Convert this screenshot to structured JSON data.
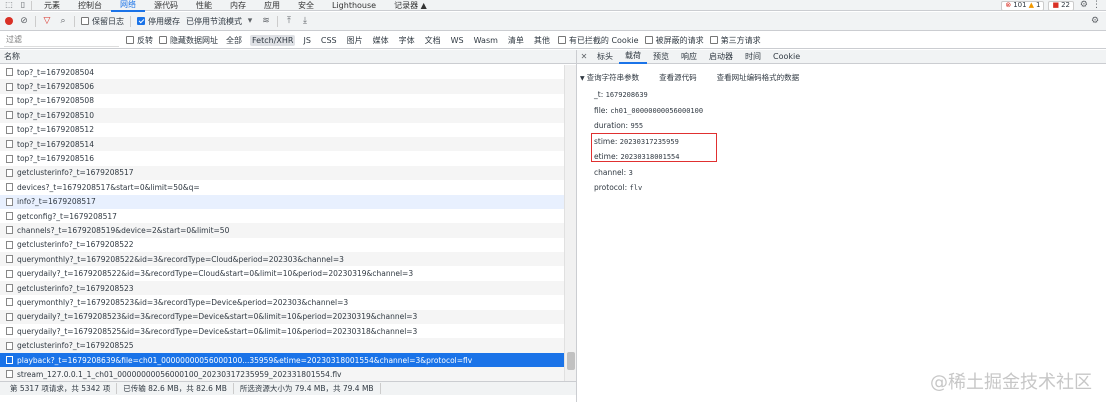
{
  "tabs": [
    "元素",
    "控制台",
    "网络",
    "源代码",
    "性能",
    "内存",
    "应用",
    "安全",
    "Lighthouse",
    "记录器 ▲"
  ],
  "active_tab": "网络",
  "counts": {
    "errors": "101",
    "warnings": "1",
    "issues": "22"
  },
  "toolbar": {
    "preserve_log": "保留日志",
    "disable_cache": "停用缓存",
    "throttle": "已停用节流模式"
  },
  "filter": {
    "placeholder": "过滤",
    "invert": "反转",
    "hide_data_urls": "隐藏数据网址",
    "types": [
      "全部",
      "Fetch/XHR",
      "JS",
      "CSS",
      "图片",
      "媒体",
      "字体",
      "文档",
      "WS",
      "Wasm",
      "清单",
      "其他"
    ],
    "selected_type": "Fetch/XHR",
    "blocked_cookies": "有已拦截的 Cookie",
    "blocked_requests": "被屏蔽的请求",
    "third_party": "第三方请求"
  },
  "list_header": "名称",
  "requests": [
    "top?_t=1679208504",
    "top?_t=1679208506",
    "top?_t=1679208508",
    "top?_t=1679208510",
    "top?_t=1679208512",
    "top?_t=1679208514",
    "top?_t=1679208516",
    "getclusterinfo?_t=1679208517",
    "devices?_t=1679208517&start=0&limit=50&q=",
    "info?_t=1679208517",
    "getconfig?_t=1679208517",
    "channels?_t=1679208519&device=2&start=0&limit=50",
    "getclusterinfo?_t=1679208522",
    "querymonthly?_t=1679208522&id=3&recordType=Cloud&period=202303&channel=3",
    "querydaily?_t=1679208522&id=3&recordType=Cloud&start=0&limit=10&period=20230319&channel=3",
    "getclusterinfo?_t=1679208523",
    "querymonthly?_t=1679208523&id=3&recordType=Device&period=202303&channel=3",
    "querydaily?_t=1679208523&id=3&recordType=Device&start=0&limit=10&period=20230319&channel=3",
    "querydaily?_t=1679208525&id=3&recordType=Device&start=0&limit=10&period=20230318&channel=3",
    "getclusterinfo?_t=1679208525",
    "playback?_t=1679208639&file=ch01_00000000056000100...35959&etime=20230318001554&channel=3&protocol=flv",
    "stream_127.0.0.1_1_ch01_00000000056000100_20230317235959_202331801554.flv"
  ],
  "status": {
    "requests": "第 5317 项请求，共 5342 项",
    "transferred": "已传输 82.6 MB，共 82.6 MB",
    "resources": "所选资源大小为 79.4 MB，共 79.4 MB"
  },
  "detail_tabs": [
    "标头",
    "载荷",
    "预览",
    "响应",
    "启动器",
    "时间",
    "Cookie"
  ],
  "active_detail_tab": "载荷",
  "payload": {
    "section": "查询字符串参数",
    "view_source": "查看源代码",
    "view_url_encoded": "查看网址编码格式的数据",
    "params": [
      {
        "k": "_t:",
        "v": "1679208639"
      },
      {
        "k": "file:",
        "v": "ch01_00000000056000100"
      },
      {
        "k": "duration:",
        "v": "955"
      },
      {
        "k": "stime:",
        "v": "20230317235959"
      },
      {
        "k": "etime:",
        "v": "20230318001554"
      },
      {
        "k": "channel:",
        "v": "3"
      },
      {
        "k": "protocol:",
        "v": "flv"
      }
    ]
  },
  "watermark": "@稀土掘金技术社区",
  "colors": {
    "accent": "#1a73e8",
    "record": "#d93025",
    "highlight_box": "#e03030"
  }
}
